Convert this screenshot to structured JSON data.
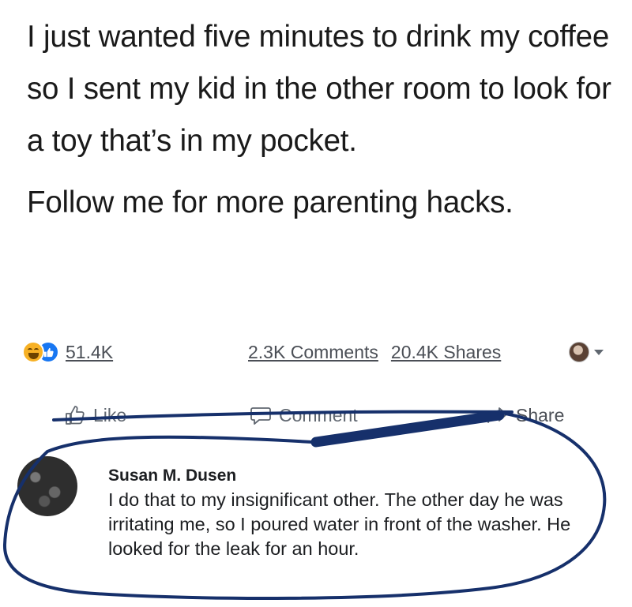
{
  "post": {
    "text_line1": "I just wanted five minutes to drink my coffee so I sent my kid in the other room to look for a toy that’s in my pocket.",
    "text_line2": "Follow me for more parenting hacks."
  },
  "stats": {
    "reaction_count": "51.4K",
    "comments": "2.3K Comments",
    "shares": "20.4K Shares",
    "reaction_icons": [
      "haha-icon",
      "like-icon"
    ]
  },
  "actions": {
    "like": "Like",
    "comment": "Comment",
    "share": "Share"
  },
  "comment": {
    "author": "Susan M. Dusen",
    "text": "I do that to my insignificant other.  The other day he was irritating me, so I poured water in front of the washer.  He looked for the leak for an hour."
  },
  "colors": {
    "ink_annotation": "#16306b",
    "haha": "#f7b125",
    "like": "#1877f2",
    "text_muted": "#606770"
  }
}
